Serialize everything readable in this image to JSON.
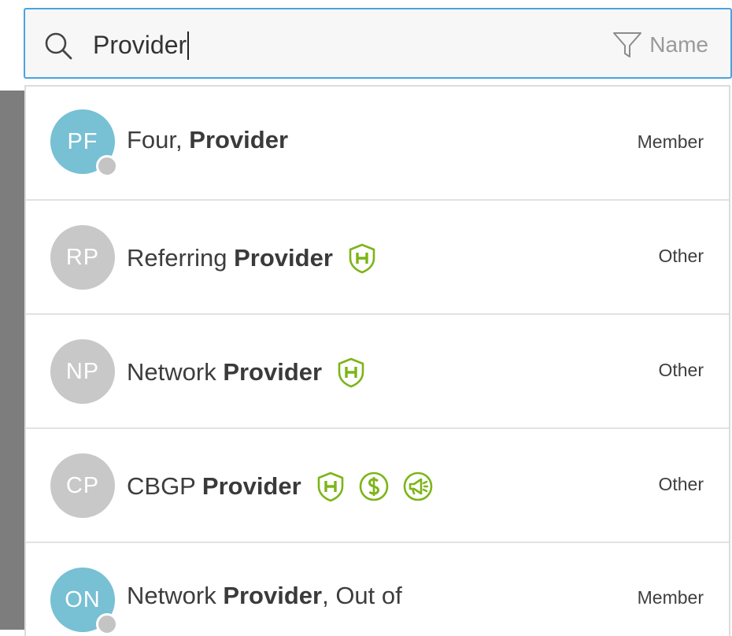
{
  "search": {
    "query": "Provider",
    "filter_label": "Name"
  },
  "results": [
    {
      "initials": "PF",
      "name_prefix": "Four, ",
      "name_match": "Provider",
      "name_suffix": "",
      "role": "Member",
      "avatar_color": "#78c0d4",
      "show_presence": true,
      "badges": []
    },
    {
      "initials": "RP",
      "name_prefix": "Referring ",
      "name_match": "Provider",
      "name_suffix": "",
      "role": "Other",
      "avatar_color": "#c8c8c8",
      "show_presence": false,
      "badges": [
        "shield-h-icon"
      ]
    },
    {
      "initials": "NP",
      "name_prefix": "Network ",
      "name_match": "Provider",
      "name_suffix": "",
      "role": "Other",
      "avatar_color": "#c8c8c8",
      "show_presence": false,
      "badges": [
        "shield-h-icon"
      ]
    },
    {
      "initials": "CP",
      "name_prefix": "CBGP ",
      "name_match": "Provider",
      "name_suffix": "",
      "role": "Other",
      "avatar_color": "#c8c8c8",
      "show_presence": false,
      "badges": [
        "shield-h-icon",
        "dollar-icon",
        "megaphone-icon"
      ]
    },
    {
      "initials": "ON",
      "name_prefix": "Network ",
      "name_match": "Provider",
      "name_suffix": ", Out of",
      "role": "Member",
      "avatar_color": "#78c0d4",
      "show_presence": true,
      "badges": []
    }
  ],
  "colors": {
    "accent_border": "#4aa3df",
    "badge_green": "#7cb518",
    "member_avatar": "#78c0d4",
    "other_avatar": "#c8c8c8"
  }
}
